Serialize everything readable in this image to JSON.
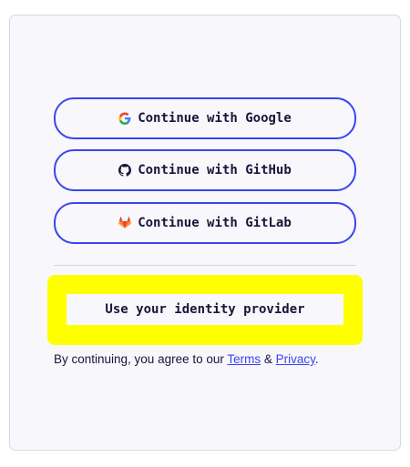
{
  "buttons": [
    {
      "label": "Continue with Google",
      "icon": "google-icon"
    },
    {
      "label": "Continue with GitHub",
      "icon": "github-icon"
    },
    {
      "label": "Continue with GitLab",
      "icon": "gitlab-icon"
    }
  ],
  "identity_provider_label": "Use your identity provider",
  "terms": {
    "prefix": "By continuing, you agree to our ",
    "terms_link": "Terms",
    "amp": " & ",
    "privacy_link": "Privacy",
    "suffix": "."
  },
  "colors": {
    "accent": "#3b44f0",
    "highlight": "#ffff00",
    "background": "#f7f7fc"
  }
}
